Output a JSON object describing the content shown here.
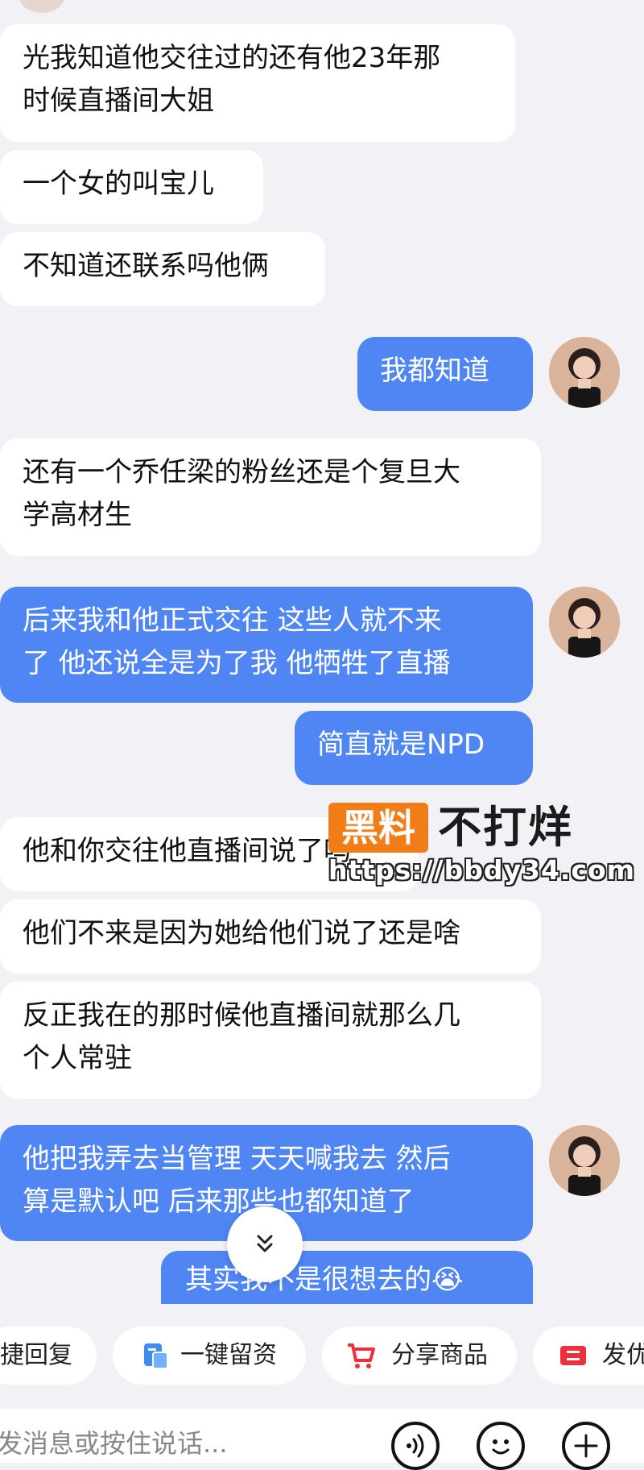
{
  "messages": [
    {
      "side": "in",
      "lines": [
        "光我知道他交往过的还有他23年那",
        "时候直播间大姐"
      ]
    },
    {
      "side": "in",
      "lines": [
        "一个女的叫宝儿"
      ]
    },
    {
      "side": "in",
      "lines": [
        "不知道还联系吗他俩"
      ]
    },
    {
      "side": "out",
      "lines": [
        "我都知道"
      ]
    },
    {
      "side": "in",
      "lines": [
        "还有一个乔任梁的粉丝还是个复旦大",
        "学高材生"
      ]
    },
    {
      "side": "out",
      "lines": [
        "后来我和他正式交往 这些人就不来",
        "了 他还说全是为了我 他牺牲了直播"
      ]
    },
    {
      "side": "out",
      "lines": [
        "简直就是NPD"
      ]
    },
    {
      "side": "in",
      "lines": [
        "他和你交往他直播间说了吗"
      ]
    },
    {
      "side": "in",
      "lines": [
        "他们不来是因为她给他们说了还是啥"
      ]
    },
    {
      "side": "in",
      "lines": [
        "反正我在的那时候他直播间就那么几",
        "个人常驻"
      ]
    },
    {
      "side": "out",
      "lines": [
        "他把我弄去当管理 天天喊我去 然后",
        "算是默认吧 后来那些也都知道了"
      ]
    },
    {
      "side": "out",
      "lines": [
        "其实我不是很想去的😭"
      ]
    }
  ],
  "watermark": {
    "badge": "黑料",
    "title": "不打烊",
    "url": "https://bbdy34.com"
  },
  "quick_replies": [
    {
      "label": "捷回复",
      "icon": "none"
    },
    {
      "label": "一键留资",
      "icon": "form-icon"
    },
    {
      "label": "分享商品",
      "icon": "cart-icon"
    },
    {
      "label": "发优",
      "icon": "coupon-icon"
    }
  ],
  "composer": {
    "placeholder": "发消息或按住说话..."
  },
  "colors": {
    "outgoing_bubble": "#4f86f4",
    "incoming_bubble": "#ffffff",
    "background": "#f2f2f6",
    "watermark_orange": "#f07d18"
  }
}
